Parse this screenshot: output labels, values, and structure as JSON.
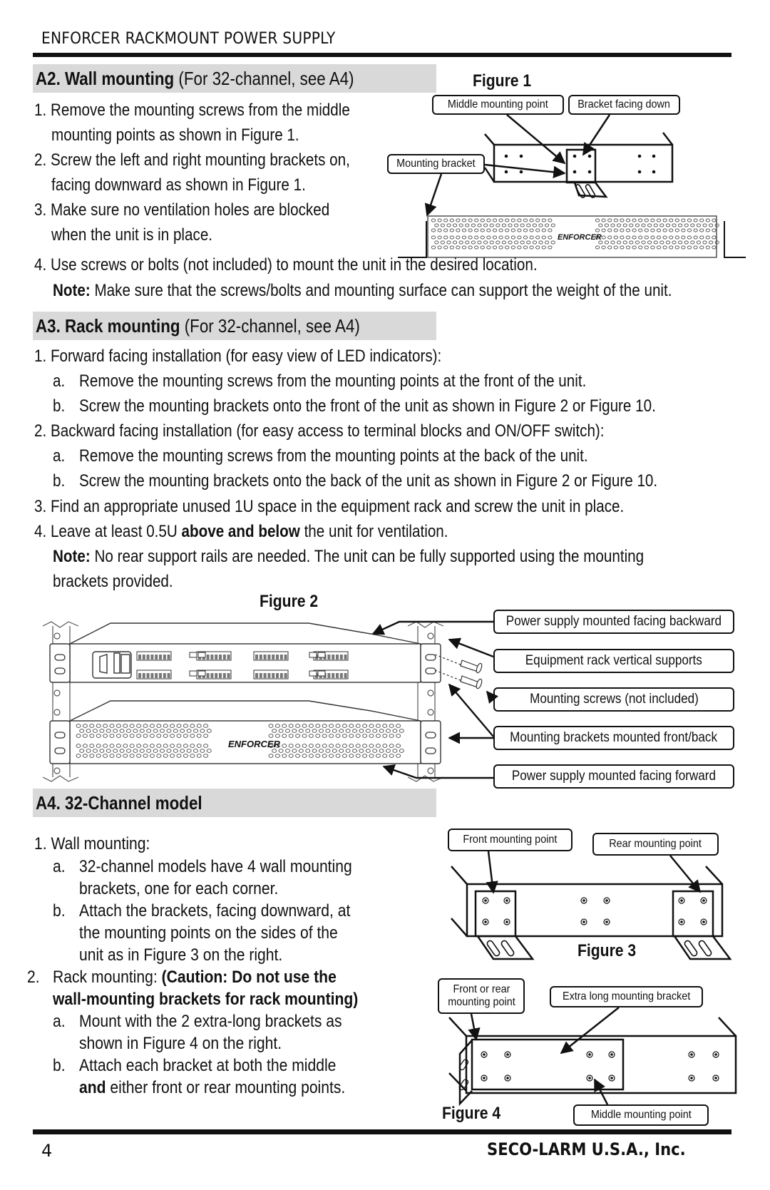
{
  "header": {
    "title": "ENFORCER RACKMOUNT POWER SUPPLY"
  },
  "a2": {
    "title_bold": "A2. Wall mounting",
    "title_rest": " (For 32-channel, see A4)",
    "lines": [
      "1. Remove the mounting screws from the middle",
      "mounting points as shown in Figure 1.",
      "2. Screw the left and right mounting brackets on,",
      "facing downward as shown in Figure 1.",
      "3. Make sure no ventilation holes are blocked",
      "when the unit is in place.",
      "4. Use screws or bolts (not included) to mount the unit in the desired location."
    ],
    "note_label": "Note:",
    "note_text": " Make sure that the screws/bolts and mounting surface can support the weight of the unit."
  },
  "figure1": {
    "label": "Figure 1",
    "callouts": [
      "Middle mounting point",
      "Bracket facing down",
      "Mounting bracket"
    ],
    "brand": "ENFORCER"
  },
  "a3": {
    "title_bold": "A3. Rack mounting",
    "title_rest": " (For 32-channel, see A4)",
    "lines": [
      "1. Forward facing installation (for easy view of LED indicators):",
      "a.",
      "Remove the mounting screws from the mounting points at the front of the unit.",
      "b.",
      "Screw the mounting brackets onto the front of the unit as shown in Figure 2 or Figure 10.",
      "2. Backward facing installation (for easy access to terminal blocks and ON/OFF switch):",
      "a.",
      "Remove the mounting screws from the mounting points at the back of the unit.",
      "b.",
      "Screw the mounting brackets onto the back of the unit as shown in Figure 2 or Figure 10.",
      "3. Find an appropriate unused 1U space in the equipment rack and screw the unit in place."
    ],
    "item4_pre": "4. Leave at least 0.5U ",
    "item4_bold": "above and below",
    "item4_post": " the unit for ventilation.",
    "note_label": "Note:",
    "note_text": " No rear support rails are needed.  The unit can be fully supported using the mounting",
    "note_text2": "brackets provided."
  },
  "figure2": {
    "label": "Figure 2",
    "callouts": [
      "Power supply mounted facing backward",
      "Equipment rack vertical supports",
      "Mounting screws (not included)",
      "Mounting brackets mounted front/back",
      "Power supply mounted facing forward"
    ],
    "brand": "ENFORCER"
  },
  "a4": {
    "title": "A4. 32-Channel model",
    "item1": "1. Wall mounting:",
    "item1a_marker": "a.",
    "item1a": [
      "32-channel models have 4 wall mounting",
      "brackets, one for each corner."
    ],
    "item1b_marker": "b.",
    "item1b": [
      "Attach the brackets, facing downward, at",
      "the mounting points on the sides of the",
      "unit as in Figure 3 on the right."
    ],
    "item2_marker": "2.",
    "item2_pre": "Rack mounting: ",
    "item2_bold1": "(Caution: Do not use the",
    "item2_bold2": "wall-mounting brackets for rack mounting)",
    "item2a_marker": "a.",
    "item2a": [
      "Mount with the 2 extra-long brackets as",
      "shown in Figure 4 on the right."
    ],
    "item2b_marker": "b.",
    "item2b_line1": "Attach each bracket at both the middle",
    "item2b_bold": "and",
    "item2b_rest": " either front or rear mounting points."
  },
  "figure3": {
    "label": "Figure 3",
    "callouts": [
      "Front mounting point",
      "Rear mounting point"
    ]
  },
  "figure4": {
    "label": "Figure 4",
    "callouts": [
      "Front or rear\nmounting point",
      "Extra long mounting bracket",
      "Middle mounting point"
    ],
    "callout0_line1": "Front or rear",
    "callout0_line2": "mounting point"
  },
  "footer": {
    "page_number": "4",
    "company": "SECO-LARM U.S.A., Inc."
  }
}
